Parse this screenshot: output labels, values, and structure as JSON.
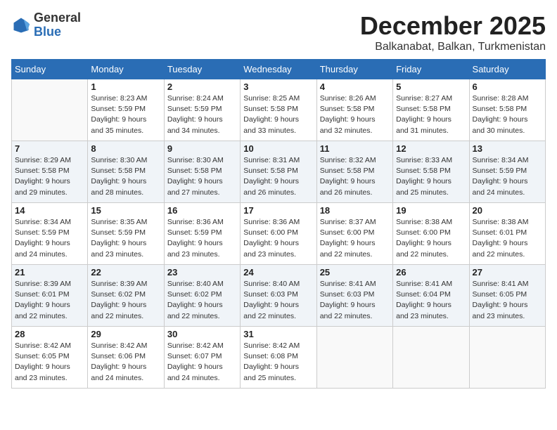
{
  "logo": {
    "general": "General",
    "blue": "Blue"
  },
  "title": "December 2025",
  "location": "Balkanabat, Balkan, Turkmenistan",
  "weekdays": [
    "Sunday",
    "Monday",
    "Tuesday",
    "Wednesday",
    "Thursday",
    "Friday",
    "Saturday"
  ],
  "weeks": [
    [
      {
        "day": "",
        "info": ""
      },
      {
        "day": "1",
        "info": "Sunrise: 8:23 AM\nSunset: 5:59 PM\nDaylight: 9 hours\nand 35 minutes."
      },
      {
        "day": "2",
        "info": "Sunrise: 8:24 AM\nSunset: 5:59 PM\nDaylight: 9 hours\nand 34 minutes."
      },
      {
        "day": "3",
        "info": "Sunrise: 8:25 AM\nSunset: 5:58 PM\nDaylight: 9 hours\nand 33 minutes."
      },
      {
        "day": "4",
        "info": "Sunrise: 8:26 AM\nSunset: 5:58 PM\nDaylight: 9 hours\nand 32 minutes."
      },
      {
        "day": "5",
        "info": "Sunrise: 8:27 AM\nSunset: 5:58 PM\nDaylight: 9 hours\nand 31 minutes."
      },
      {
        "day": "6",
        "info": "Sunrise: 8:28 AM\nSunset: 5:58 PM\nDaylight: 9 hours\nand 30 minutes."
      }
    ],
    [
      {
        "day": "7",
        "info": "Sunrise: 8:29 AM\nSunset: 5:58 PM\nDaylight: 9 hours\nand 29 minutes."
      },
      {
        "day": "8",
        "info": "Sunrise: 8:30 AM\nSunset: 5:58 PM\nDaylight: 9 hours\nand 28 minutes."
      },
      {
        "day": "9",
        "info": "Sunrise: 8:30 AM\nSunset: 5:58 PM\nDaylight: 9 hours\nand 27 minutes."
      },
      {
        "day": "10",
        "info": "Sunrise: 8:31 AM\nSunset: 5:58 PM\nDaylight: 9 hours\nand 26 minutes."
      },
      {
        "day": "11",
        "info": "Sunrise: 8:32 AM\nSunset: 5:58 PM\nDaylight: 9 hours\nand 26 minutes."
      },
      {
        "day": "12",
        "info": "Sunrise: 8:33 AM\nSunset: 5:58 PM\nDaylight: 9 hours\nand 25 minutes."
      },
      {
        "day": "13",
        "info": "Sunrise: 8:34 AM\nSunset: 5:59 PM\nDaylight: 9 hours\nand 24 minutes."
      }
    ],
    [
      {
        "day": "14",
        "info": "Sunrise: 8:34 AM\nSunset: 5:59 PM\nDaylight: 9 hours\nand 24 minutes."
      },
      {
        "day": "15",
        "info": "Sunrise: 8:35 AM\nSunset: 5:59 PM\nDaylight: 9 hours\nand 23 minutes."
      },
      {
        "day": "16",
        "info": "Sunrise: 8:36 AM\nSunset: 5:59 PM\nDaylight: 9 hours\nand 23 minutes."
      },
      {
        "day": "17",
        "info": "Sunrise: 8:36 AM\nSunset: 6:00 PM\nDaylight: 9 hours\nand 23 minutes."
      },
      {
        "day": "18",
        "info": "Sunrise: 8:37 AM\nSunset: 6:00 PM\nDaylight: 9 hours\nand 22 minutes."
      },
      {
        "day": "19",
        "info": "Sunrise: 8:38 AM\nSunset: 6:00 PM\nDaylight: 9 hours\nand 22 minutes."
      },
      {
        "day": "20",
        "info": "Sunrise: 8:38 AM\nSunset: 6:01 PM\nDaylight: 9 hours\nand 22 minutes."
      }
    ],
    [
      {
        "day": "21",
        "info": "Sunrise: 8:39 AM\nSunset: 6:01 PM\nDaylight: 9 hours\nand 22 minutes."
      },
      {
        "day": "22",
        "info": "Sunrise: 8:39 AM\nSunset: 6:02 PM\nDaylight: 9 hours\nand 22 minutes."
      },
      {
        "day": "23",
        "info": "Sunrise: 8:40 AM\nSunset: 6:02 PM\nDaylight: 9 hours\nand 22 minutes."
      },
      {
        "day": "24",
        "info": "Sunrise: 8:40 AM\nSunset: 6:03 PM\nDaylight: 9 hours\nand 22 minutes."
      },
      {
        "day": "25",
        "info": "Sunrise: 8:41 AM\nSunset: 6:03 PM\nDaylight: 9 hours\nand 22 minutes."
      },
      {
        "day": "26",
        "info": "Sunrise: 8:41 AM\nSunset: 6:04 PM\nDaylight: 9 hours\nand 23 minutes."
      },
      {
        "day": "27",
        "info": "Sunrise: 8:41 AM\nSunset: 6:05 PM\nDaylight: 9 hours\nand 23 minutes."
      }
    ],
    [
      {
        "day": "28",
        "info": "Sunrise: 8:42 AM\nSunset: 6:05 PM\nDaylight: 9 hours\nand 23 minutes."
      },
      {
        "day": "29",
        "info": "Sunrise: 8:42 AM\nSunset: 6:06 PM\nDaylight: 9 hours\nand 24 minutes."
      },
      {
        "day": "30",
        "info": "Sunrise: 8:42 AM\nSunset: 6:07 PM\nDaylight: 9 hours\nand 24 minutes."
      },
      {
        "day": "31",
        "info": "Sunrise: 8:42 AM\nSunset: 6:08 PM\nDaylight: 9 hours\nand 25 minutes."
      },
      {
        "day": "",
        "info": ""
      },
      {
        "day": "",
        "info": ""
      },
      {
        "day": "",
        "info": ""
      }
    ]
  ]
}
